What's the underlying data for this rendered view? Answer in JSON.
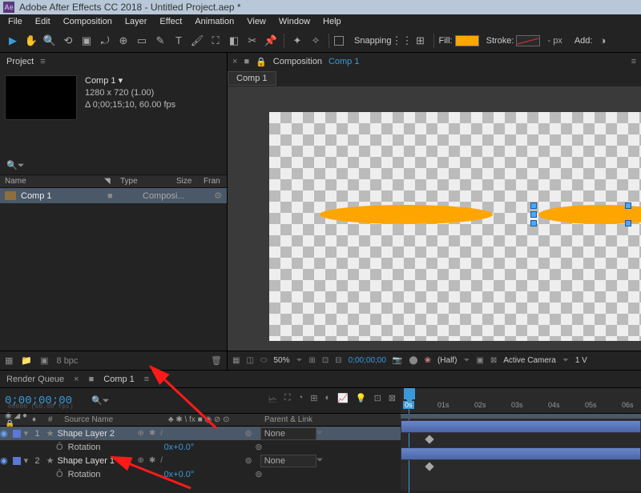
{
  "title": "Adobe After Effects CC 2018 - Untitled Project.aep *",
  "menu": [
    "File",
    "Edit",
    "Composition",
    "Layer",
    "Effect",
    "Animation",
    "View",
    "Window",
    "Help"
  ],
  "toolbar": {
    "snapping": "Snapping",
    "fill": "Fill:",
    "stroke": "Stroke:",
    "strokepx": "- px",
    "add": "Add:"
  },
  "project": {
    "title": "Project",
    "comp": {
      "name": "Comp 1 ▾",
      "dims": "1280 x 720 (1.00)",
      "dur": "Δ 0;00;15;10, 60.00 fps"
    },
    "cols": {
      "name": "Name",
      "type": "Type",
      "size": "Size",
      "fra": "Fran"
    },
    "row": {
      "name": "Comp 1",
      "type": "Composi..."
    },
    "bpc": "8 bpc"
  },
  "composition": {
    "label": "Composition",
    "name": "Comp 1",
    "tab": "Comp 1"
  },
  "viewer": {
    "zoom": "50%",
    "time": "0;00;00;00",
    "half": "(Half)",
    "camera": "Active Camera",
    "view": "1 V"
  },
  "timeline": {
    "renderq": "Render Queue",
    "comp": "Comp 1",
    "time": "0;00;00;00",
    "smpte": "00000 (60.00 fps)",
    "cols": {
      "src": "Source Name",
      "sw": "♣ ✱ \\ fx ■ ◉ ⊘ ⊙",
      "pl": "Parent & Link"
    },
    "ticks": [
      "0s",
      "01s",
      "02s",
      "03s",
      "04s",
      "05s",
      "06s"
    ],
    "layers": [
      {
        "num": "1",
        "name": "Shape Layer 2",
        "parent": "None"
      },
      {
        "num": "2",
        "name": "Shape Layer 1",
        "parent": "None"
      }
    ],
    "prop": {
      "name": "Rotation",
      "val": "0x+0.0°"
    }
  }
}
